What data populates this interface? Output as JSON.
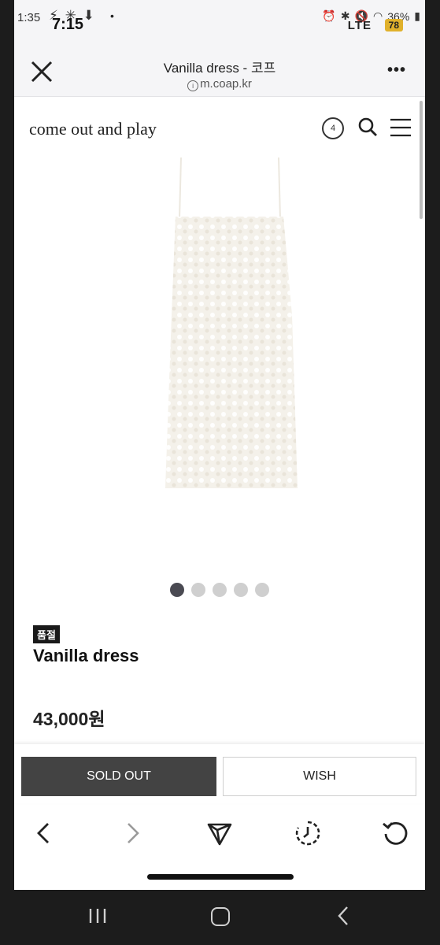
{
  "status_bar": {
    "time_small": "1:35",
    "time_big": "7:15",
    "battery_percent": "36%",
    "network": "LTE",
    "badge": "78"
  },
  "browser": {
    "title": "Vanilla dress - 코프",
    "url": "m.coap.kr"
  },
  "site": {
    "logo": "come out and play",
    "cart_count": "4"
  },
  "product": {
    "badge": "품절",
    "name": "Vanilla dress",
    "price": "43,000원",
    "image_count": 5,
    "active_image": 0
  },
  "actions": {
    "soldout_label": "SOLD OUT",
    "wish_label": "WISH"
  },
  "colors": {
    "soldout_button": "#434343",
    "active_dot": "#4a4a52",
    "inactive_dot": "#cfcfcf",
    "dress": "#f4f1ea"
  },
  "icons": [
    "close-icon",
    "more-icon",
    "cart-icon",
    "search-icon",
    "menu-icon",
    "back-icon",
    "forward-icon",
    "share-icon",
    "history-icon",
    "refresh-icon",
    "recent-apps-icon",
    "home-icon",
    "android-back-icon"
  ]
}
